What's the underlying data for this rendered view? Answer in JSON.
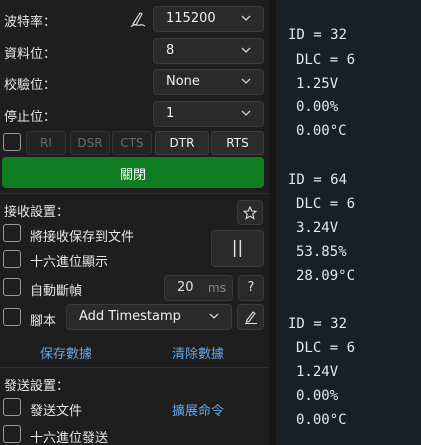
{
  "serial": {
    "baud_label": "波特率：",
    "baud_value": "115200",
    "databits_label": "資料位：",
    "databits_value": "8",
    "parity_label": "校驗位：",
    "parity_value": "None",
    "stopbits_label": "停止位：",
    "stopbits_value": "1",
    "signals": [
      "RI",
      "DSR",
      "CTS",
      "DTR",
      "RTS"
    ],
    "close_button": "關閉"
  },
  "receive": {
    "section_label": "接收設置：",
    "save_to_file": "將接收保存到文件",
    "hex_display": "十六進位顯示",
    "auto_frame": "自動斷幀",
    "frame_ms_value": "20",
    "frame_ms_unit": "ms",
    "help": "?",
    "pause_icon": "||",
    "script_label": "腳本",
    "script_value": "Add Timestamp",
    "save_data": "保存數據",
    "clear_data": "清除數據"
  },
  "send": {
    "section_label": "發送設置：",
    "send_file": "發送文件",
    "hex_send": "十六進位發送",
    "extend_command": "擴展命令"
  },
  "icons": {
    "baud_icon": "pen-signature-icon",
    "star": "star-icon",
    "script_edit": "edit-pen-icon"
  },
  "colors": {
    "close_button_bg": "#117d22",
    "link": "#64a4e8",
    "log_bg": "#181f25"
  },
  "log": {
    "frames": [
      {
        "id": "ID = 32",
        "dlc": "DLC = 6",
        "voltage": "1.25V",
        "percent": "0.00%",
        "temp": "0.00°C"
      },
      {
        "id": "ID = 64",
        "dlc": "DLC = 6",
        "voltage": "3.24V",
        "percent": "53.85%",
        "temp": "28.09°C"
      },
      {
        "id": "ID = 32",
        "dlc": "DLC = 6",
        "voltage": "1.24V",
        "percent": "0.00%",
        "temp": "0.00°C"
      }
    ]
  }
}
